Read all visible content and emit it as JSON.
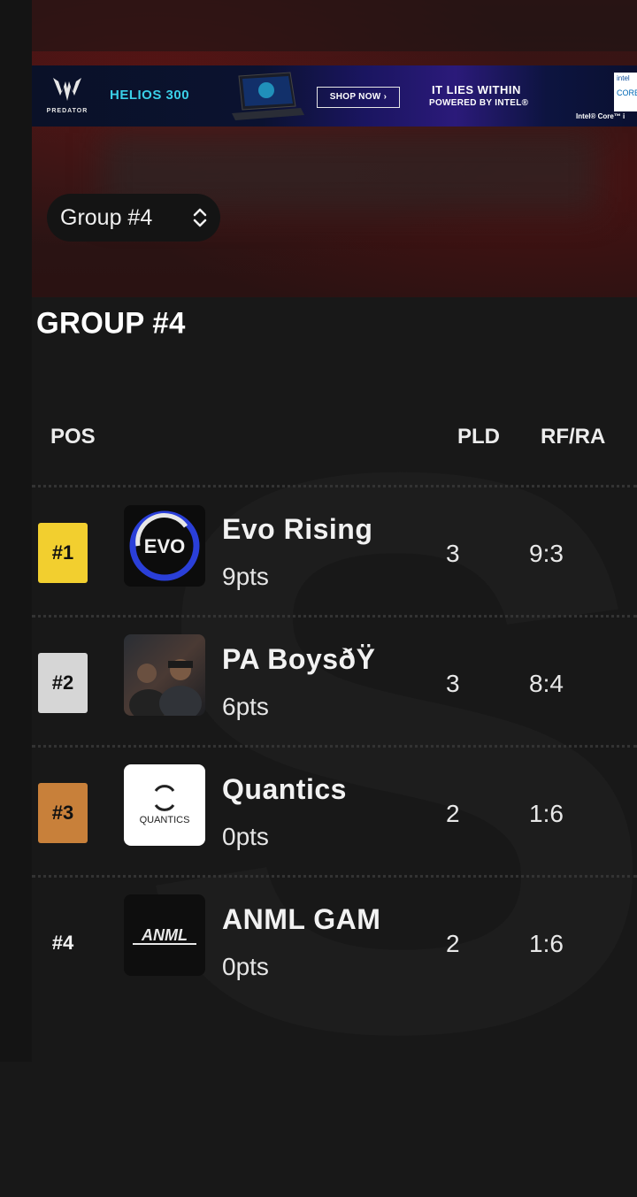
{
  "ad": {
    "brand": "PREDATOR",
    "product": "HELIOS 300",
    "cta": "SHOP NOW ›",
    "tagline_1": "IT LIES WITHIN",
    "tagline_2": "POWERED BY INTEL®",
    "badge_top": "intel",
    "badge_core": "CORE",
    "fine_print": "Intel® Core™ i"
  },
  "group_selector": {
    "label": "Group #4",
    "icon": "chevron-up-down-icon"
  },
  "section": {
    "title": "GROUP #4"
  },
  "table": {
    "headers": {
      "pos": "POS",
      "pld": "PLD",
      "rfra": "RF/RA"
    },
    "rows": [
      {
        "pos": "#1",
        "badge_color": "#f2cf2f",
        "badge_text_color": "#111111",
        "team": "Evo Rising",
        "pts": "9pts",
        "pld": "3",
        "rfra": "9:3",
        "logo_text": "EVO"
      },
      {
        "pos": "#2",
        "badge_color": "#d6d6d6",
        "badge_text_color": "#111111",
        "team": "PA BoysðŸ",
        "pts": "6pts",
        "pld": "3",
        "rfra": "8:4",
        "logo_text": ""
      },
      {
        "pos": "#3",
        "badge_color": "#c8803a",
        "badge_text_color": "#111111",
        "team": "Quantics",
        "pts": "0pts",
        "pld": "2",
        "rfra": "1:6",
        "logo_text": "QUANTICS"
      },
      {
        "pos": "#4",
        "badge_color": "transparent",
        "badge_text_color": "#f2f2f2",
        "team": "ANML GAM",
        "pts": "0pts",
        "pld": "2",
        "rfra": "1:6",
        "logo_text": "ANML"
      }
    ]
  }
}
